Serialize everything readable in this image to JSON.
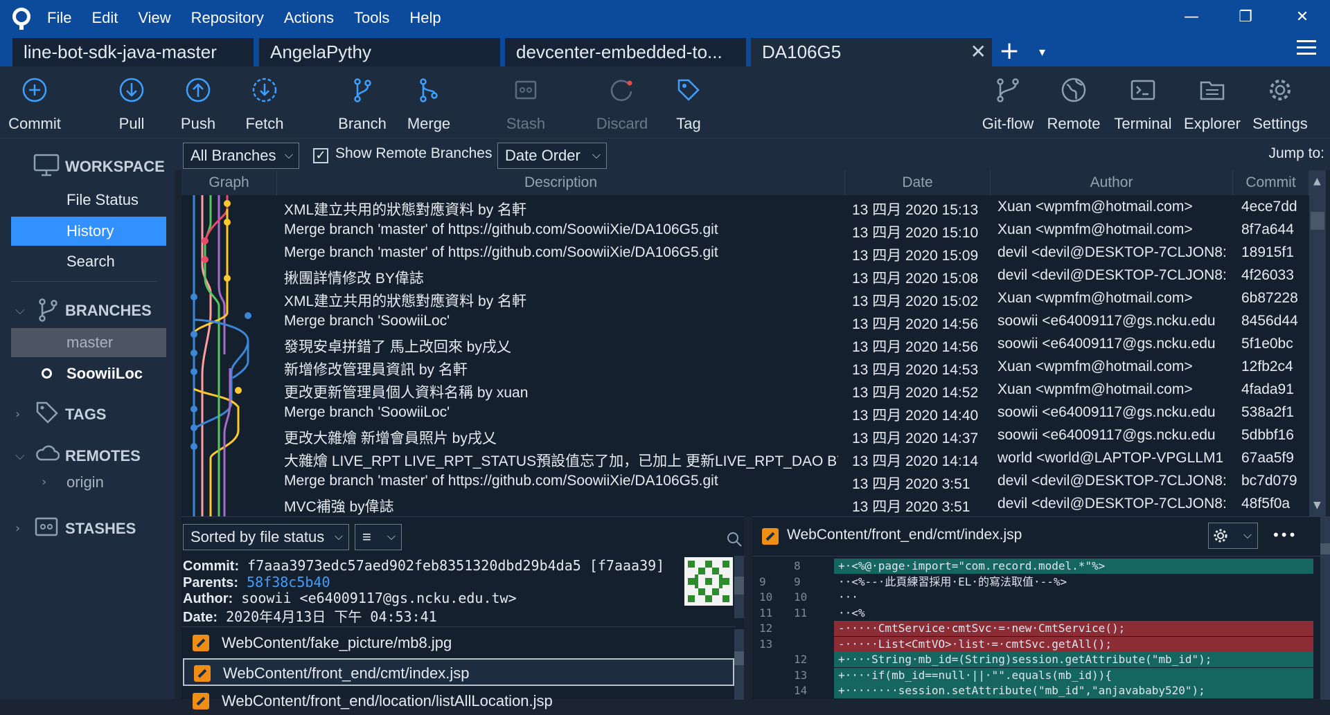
{
  "menu": {
    "items": [
      "File",
      "Edit",
      "View",
      "Repository",
      "Actions",
      "Tools",
      "Help"
    ]
  },
  "window": {
    "minimize": "—",
    "restore": "❐",
    "close": "✕"
  },
  "tabs": [
    {
      "label": "line-bot-sdk-java-master",
      "active": false
    },
    {
      "label": "AngelaPythy",
      "active": false
    },
    {
      "label": "devcenter-embedded-to...",
      "active": false
    },
    {
      "label": "DA106G5",
      "active": true
    }
  ],
  "tab_controls": {
    "add": "+",
    "dropdown": "▾",
    "close": "✕"
  },
  "toolbar": {
    "commit": "Commit",
    "pull": "Pull",
    "push": "Push",
    "fetch": "Fetch",
    "branch": "Branch",
    "merge": "Merge",
    "stash": "Stash",
    "discard": "Discard",
    "tag": "Tag",
    "gitflow": "Git-flow",
    "remote": "Remote",
    "terminal": "Terminal",
    "explorer": "Explorer",
    "settings": "Settings"
  },
  "sidebar": {
    "workspace": "WORKSPACE",
    "file_status": "File Status",
    "history": "History",
    "search": "Search",
    "branches": "BRANCHES",
    "master": "master",
    "current_branch": "SoowiiLoc",
    "tags": "TAGS",
    "remotes": "REMOTES",
    "origin": "origin",
    "stashes": "STASHES"
  },
  "filter": {
    "branches": "All Branches",
    "show_remote": "Show Remote Branches",
    "order": "Date Order",
    "jump_to": "Jump to:"
  },
  "history": {
    "columns": {
      "graph": "Graph",
      "description": "Description",
      "date": "Date",
      "author": "Author",
      "commit": "Commit"
    },
    "rows": [
      {
        "desc": "XML建立共用的狀態對應資料 by 名軒",
        "date": "13 四月 2020 15:13",
        "author": "Xuan <wpmfm@hotmail.com>",
        "commit": "4ece7dd"
      },
      {
        "desc": "Merge branch 'master' of https://github.com/SoowiiXie/DA106G5.git",
        "date": "13 四月 2020 15:10",
        "author": "Xuan <wpmfm@hotmail.com>",
        "commit": "8f7a644"
      },
      {
        "desc": "Merge branch 'master' of https://github.com/SoowiiXie/DA106G5.git",
        "date": "13 四月 2020 15:09",
        "author": "devil <devil@DESKTOP-7CLJON8:",
        "commit": "18915f1"
      },
      {
        "desc": "揪團詳情修改 BY偉誌",
        "date": "13 四月 2020 15:08",
        "author": "devil <devil@DESKTOP-7CLJON8:",
        "commit": "4f26033"
      },
      {
        "desc": "XML建立共用的狀態對應資料 by 名軒",
        "date": "13 四月 2020 15:02",
        "author": "Xuan <wpmfm@hotmail.com>",
        "commit": "6b87228"
      },
      {
        "desc": "Merge branch 'SoowiiLoc'",
        "date": "13 四月 2020 14:56",
        "author": "soowii <e64009117@gs.ncku.edu",
        "commit": "8456d44"
      },
      {
        "desc": "發現安卓拼錯了 馬上改回來 by戌乂",
        "date": "13 四月 2020 14:56",
        "author": "soowii <e64009117@gs.ncku.edu",
        "commit": "5f1e0bc"
      },
      {
        "desc": "新增修改管理員資訊 by 名軒",
        "date": "13 四月 2020 14:53",
        "author": "Xuan <wpmfm@hotmail.com>",
        "commit": "12fb2c4"
      },
      {
        "desc": "更改更新管理員個人資料名稱 by xuan",
        "date": "13 四月 2020 14:52",
        "author": "Xuan <wpmfm@hotmail.com>",
        "commit": "4fada91"
      },
      {
        "desc": "Merge branch 'SoowiiLoc'",
        "date": "13 四月 2020 14:40",
        "author": "soowii <e64009117@gs.ncku.edu",
        "commit": "538a2f1"
      },
      {
        "desc": "更改大雜燴 新增會員照片 by戌乂",
        "date": "13 四月 2020 14:37",
        "author": "soowii <e64009117@gs.ncku.edu",
        "commit": "5dbbf16"
      },
      {
        "desc": "大雜燴 LIVE_RPT LIVE_RPT_STATUS預設值忘了加，已加上 更新LIVE_RPT_DAO BY以",
        "date": "13 四月 2020 14:14",
        "author": "world <world@LAPTOP-VPGLLM1",
        "commit": "67aa5f9"
      },
      {
        "desc": "Merge branch 'master' of https://github.com/SoowiiXie/DA106G5.git",
        "date": "13 四月 2020 3:51",
        "author": "devil <devil@DESKTOP-7CLJON8:",
        "commit": "bc7d079"
      },
      {
        "desc": "MVC補強 by偉誌",
        "date": "13 四月 2020 3:51",
        "author": "devil <devil@DESKTOP-7CLJON8:",
        "commit": "48f5f0a"
      }
    ]
  },
  "details": {
    "sort": "Sorted by file status",
    "list_mode": "≡",
    "commit_label": "Commit:",
    "commit_value": "f7aaa3973edc57aed902feb8351320dbd29b4da5 [f7aaa39]",
    "parents_label": "Parents:",
    "parents_value": "58f38c5b40",
    "author_label": "Author:",
    "author_value": "soowii <e64009117@gs.ncku.edu.tw>",
    "date_label": "Date:",
    "date_value": "2020年4月13日 下午 04:53:41",
    "files": [
      "WebContent/fake_picture/mb8.jpg",
      "WebContent/front_end/cmt/index.jsp",
      "WebContent/front_end/location/listAllLocation.jsp"
    ]
  },
  "diff": {
    "file": "WebContent/front_end/cmt/index.jsp",
    "more": "•••",
    "lines": [
      {
        "old": "",
        "new": "8",
        "type": "add",
        "text": "+·<%@·page·import=\"com.record.model.*\"%>"
      },
      {
        "old": "9",
        "new": "9",
        "type": "ctx",
        "text": "··<%--·此頁練習採用·EL·的寫法取值·--%>"
      },
      {
        "old": "10",
        "new": "10",
        "type": "ctx",
        "text": "···"
      },
      {
        "old": "11",
        "new": "11",
        "type": "ctx",
        "text": "··<%"
      },
      {
        "old": "12",
        "new": "",
        "type": "del",
        "text": "-·····CmtService·cmtSvc·=·new·CmtService();"
      },
      {
        "old": "13",
        "new": "",
        "type": "del",
        "text": "-·····List<CmtVO>·list·=·cmtSvc.getAll();"
      },
      {
        "old": "",
        "new": "12",
        "type": "add",
        "text": "+····String·mb_id=(String)session.getAttribute(\"mb_id\");"
      },
      {
        "old": "",
        "new": "13",
        "type": "add",
        "text": "+····if(mb_id==null·||·\"\".equals(mb_id)){"
      },
      {
        "old": "",
        "new": "14",
        "type": "add",
        "text": "+········session.setAttribute(\"mb_id\",\"anjavababy520\");"
      }
    ]
  },
  "colors": {
    "accent": "#3290ff",
    "titlebar": "#0c4a9b",
    "added": "#15665f",
    "removed": "#8c2c35",
    "modified": "#f08d15"
  }
}
